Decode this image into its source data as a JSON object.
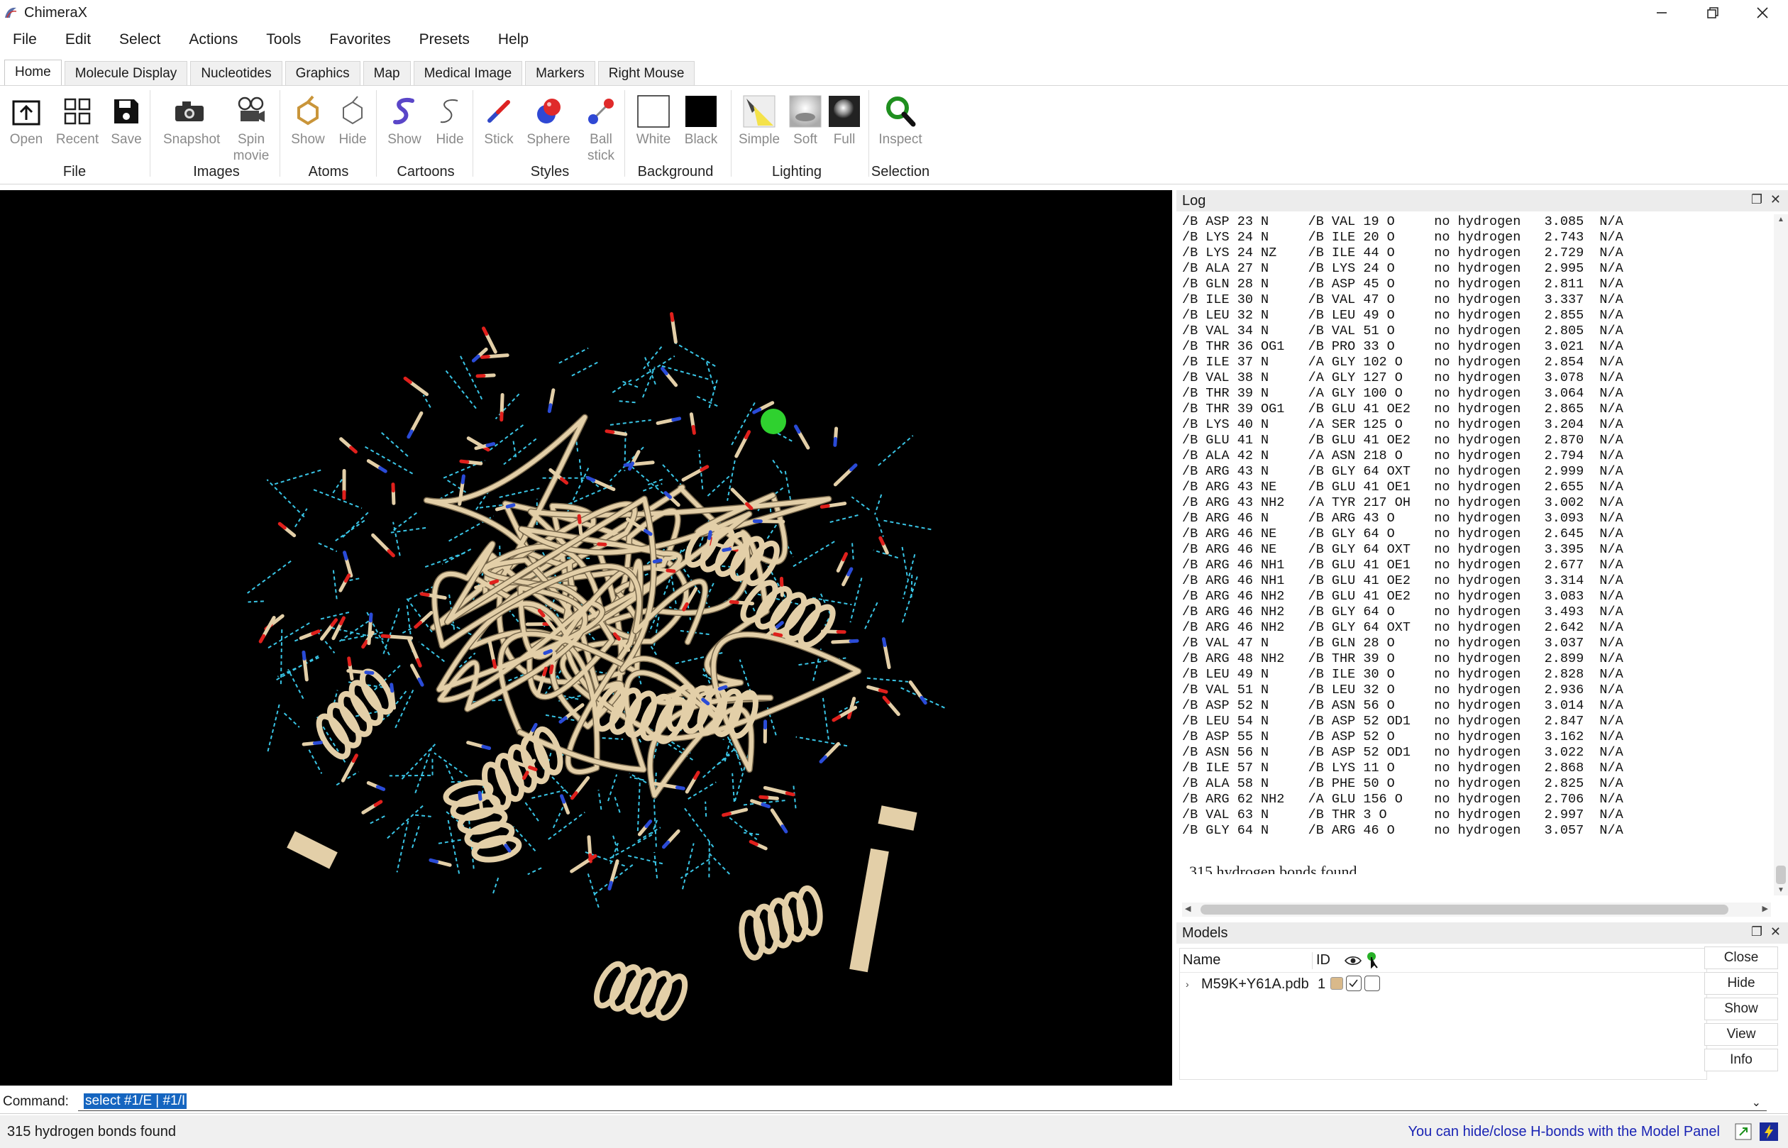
{
  "window": {
    "title": "ChimeraX",
    "controls": [
      "minimize",
      "maximize",
      "close"
    ]
  },
  "menu": [
    "File",
    "Edit",
    "Select",
    "Actions",
    "Tools",
    "Favorites",
    "Presets",
    "Help"
  ],
  "tabs": [
    "Home",
    "Molecule Display",
    "Nucleotides",
    "Graphics",
    "Map",
    "Medical Image",
    "Markers",
    "Right Mouse"
  ],
  "active_tab": "Home",
  "toolbar": {
    "groups": [
      {
        "label": "File",
        "tools": [
          {
            "label": "Open",
            "icon": "open-icon"
          },
          {
            "label": "Recent",
            "icon": "recent-grid-icon"
          },
          {
            "label": "Save",
            "icon": "save-disk-icon"
          }
        ]
      },
      {
        "label": "Images",
        "tools": [
          {
            "label": "Snapshot",
            "icon": "camera-icon"
          },
          {
            "label": "Spin\nmovie",
            "icon": "movie-camera-icon"
          }
        ]
      },
      {
        "label": "Atoms",
        "tools": [
          {
            "label": "Show",
            "icon": "atoms-show-icon"
          },
          {
            "label": "Hide",
            "icon": "atoms-hide-icon"
          }
        ]
      },
      {
        "label": "Cartoons",
        "tools": [
          {
            "label": "Show",
            "icon": "cartoon-show-icon"
          },
          {
            "label": "Hide",
            "icon": "cartoon-hide-icon"
          }
        ]
      },
      {
        "label": "Styles",
        "tools": [
          {
            "label": "Stick",
            "icon": "stick-icon"
          },
          {
            "label": "Sphere",
            "icon": "sphere-icon"
          },
          {
            "label": "Ball\nstick",
            "icon": "ball-stick-icon"
          }
        ]
      },
      {
        "label": "Background",
        "tools": [
          {
            "label": "White",
            "icon": "white-swatch-icon"
          },
          {
            "label": "Black",
            "icon": "black-swatch-icon"
          }
        ]
      },
      {
        "label": "Lighting",
        "tools": [
          {
            "label": "Simple",
            "icon": "simple-light-icon"
          },
          {
            "label": "Soft",
            "icon": "soft-light-icon"
          },
          {
            "label": "Full",
            "icon": "full-light-icon"
          }
        ]
      },
      {
        "label": "Selection",
        "tools": [
          {
            "label": "Inspect",
            "icon": "magnifier-icon"
          }
        ]
      }
    ]
  },
  "log": {
    "title": "Log",
    "rows": [
      [
        "/B ASP 23 N",
        "/B VAL 19 O",
        "no hydrogen",
        "3.085",
        "N/A"
      ],
      [
        "/B LYS 24 N",
        "/B ILE 20 O",
        "no hydrogen",
        "2.743",
        "N/A"
      ],
      [
        "/B LYS 24 NZ",
        "/B ILE 44 O",
        "no hydrogen",
        "2.729",
        "N/A"
      ],
      [
        "/B ALA 27 N",
        "/B LYS 24 O",
        "no hydrogen",
        "2.995",
        "N/A"
      ],
      [
        "/B GLN 28 N",
        "/B ASP 45 O",
        "no hydrogen",
        "2.811",
        "N/A"
      ],
      [
        "/B ILE 30 N",
        "/B VAL 47 O",
        "no hydrogen",
        "3.337",
        "N/A"
      ],
      [
        "/B LEU 32 N",
        "/B LEU 49 O",
        "no hydrogen",
        "2.855",
        "N/A"
      ],
      [
        "/B VAL 34 N",
        "/B VAL 51 O",
        "no hydrogen",
        "2.805",
        "N/A"
      ],
      [
        "/B THR 36 OG1",
        "/B PRO 33 O",
        "no hydrogen",
        "3.021",
        "N/A"
      ],
      [
        "/B ILE 37 N",
        "/A GLY 102 O",
        "no hydrogen",
        "2.854",
        "N/A"
      ],
      [
        "/B VAL 38 N",
        "/A GLY 127 O",
        "no hydrogen",
        "3.078",
        "N/A"
      ],
      [
        "/B THR 39 N",
        "/A GLY 100 O",
        "no hydrogen",
        "3.064",
        "N/A"
      ],
      [
        "/B THR 39 OG1",
        "/B GLU 41 OE2",
        "no hydrogen",
        "2.865",
        "N/A"
      ],
      [
        "/B LYS 40 N",
        "/A SER 125 O",
        "no hydrogen",
        "3.204",
        "N/A"
      ],
      [
        "/B GLU 41 N",
        "/B GLU 41 OE2",
        "no hydrogen",
        "2.870",
        "N/A"
      ],
      [
        "/B ALA 42 N",
        "/A ASN 218 O",
        "no hydrogen",
        "2.794",
        "N/A"
      ],
      [
        "/B ARG 43 N",
        "/B GLY 64 OXT",
        "no hydrogen",
        "2.999",
        "N/A"
      ],
      [
        "/B ARG 43 NE",
        "/B GLU 41 OE1",
        "no hydrogen",
        "2.655",
        "N/A"
      ],
      [
        "/B ARG 43 NH2",
        "/A TYR 217 OH",
        "no hydrogen",
        "3.002",
        "N/A"
      ],
      [
        "/B ARG 46 N",
        "/B ARG 43 O",
        "no hydrogen",
        "3.093",
        "N/A"
      ],
      [
        "/B ARG 46 NE",
        "/B GLY 64 O",
        "no hydrogen",
        "2.645",
        "N/A"
      ],
      [
        "/B ARG 46 NE",
        "/B GLY 64 OXT",
        "no hydrogen",
        "3.395",
        "N/A"
      ],
      [
        "/B ARG 46 NH1",
        "/B GLU 41 OE1",
        "no hydrogen",
        "2.677",
        "N/A"
      ],
      [
        "/B ARG 46 NH1",
        "/B GLU 41 OE2",
        "no hydrogen",
        "3.314",
        "N/A"
      ],
      [
        "/B ARG 46 NH2",
        "/B GLU 41 OE2",
        "no hydrogen",
        "3.083",
        "N/A"
      ],
      [
        "/B ARG 46 NH2",
        "/B GLY 64 O",
        "no hydrogen",
        "3.493",
        "N/A"
      ],
      [
        "/B ARG 46 NH2",
        "/B GLY 64 OXT",
        "no hydrogen",
        "2.642",
        "N/A"
      ],
      [
        "/B VAL 47 N",
        "/B GLN 28 O",
        "no hydrogen",
        "3.037",
        "N/A"
      ],
      [
        "/B ARG 48 NH2",
        "/B THR 39 O",
        "no hydrogen",
        "2.899",
        "N/A"
      ],
      [
        "/B LEU 49 N",
        "/B ILE 30 O",
        "no hydrogen",
        "2.828",
        "N/A"
      ],
      [
        "/B VAL 51 N",
        "/B LEU 32 O",
        "no hydrogen",
        "2.936",
        "N/A"
      ],
      [
        "/B ASP 52 N",
        "/B ASN 56 O",
        "no hydrogen",
        "3.014",
        "N/A"
      ],
      [
        "/B LEU 54 N",
        "/B ASP 52 OD1",
        "no hydrogen",
        "2.847",
        "N/A"
      ],
      [
        "/B ASP 55 N",
        "/B ASP 52 O",
        "no hydrogen",
        "3.162",
        "N/A"
      ],
      [
        "/B ASN 56 N",
        "/B ASP 52 OD1",
        "no hydrogen",
        "3.022",
        "N/A"
      ],
      [
        "/B ILE 57 N",
        "/B LYS 11 O",
        "no hydrogen",
        "2.868",
        "N/A"
      ],
      [
        "/B ALA 58 N",
        "/B PHE 50 O",
        "no hydrogen",
        "2.825",
        "N/A"
      ],
      [
        "/B ARG 62 NH2",
        "/A GLU 156 O",
        "no hydrogen",
        "2.706",
        "N/A"
      ],
      [
        "/B VAL 63 N",
        "/B THR 3 O",
        "no hydrogen",
        "2.997",
        "N/A"
      ],
      [
        "/B GLY 64 N",
        "/B ARG 46 O",
        "no hydrogen",
        "3.057",
        "N/A"
      ]
    ],
    "summary": "315 hydrogen bonds found"
  },
  "models": {
    "title": "Models",
    "columns": [
      "Name",
      "ID"
    ],
    "rows": [
      {
        "name": "M59K+Y61A.pdb",
        "id": "1",
        "color": "#d9b98a",
        "shown": true,
        "selected": false
      }
    ],
    "buttons": [
      "Close",
      "Hide",
      "Show",
      "View",
      "Info"
    ]
  },
  "command": {
    "label": "Command:",
    "value": "select #1/E | #1/I"
  },
  "status": {
    "left": "315 hydrogen bonds found",
    "right": "You can hide/close H-bonds with the Model Panel"
  },
  "colors": {
    "ribbon": "#e3cfa8",
    "hbond": "#39c5e6",
    "oxygen": "#e0201c",
    "nitrogen": "#2a4bd7",
    "ion": "#2fd12f",
    "background": "#000000",
    "selection": "#1565c0",
    "status_link": "#1a24b4"
  }
}
